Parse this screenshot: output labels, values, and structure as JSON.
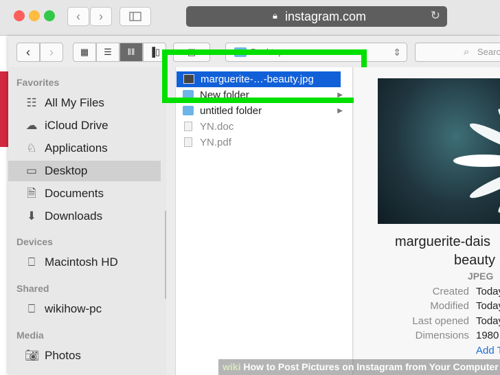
{
  "browser": {
    "url": "instagram.com"
  },
  "picker": {
    "location": "Desktop",
    "search_placeholder": "Search"
  },
  "sidebar": {
    "favorites_header": "Favorites",
    "favorites": [
      "All My Files",
      "iCloud Drive",
      "Applications",
      "Desktop",
      "Documents",
      "Downloads"
    ],
    "devices_header": "Devices",
    "devices": [
      "Macintosh HD"
    ],
    "shared_header": "Shared",
    "shared": [
      "wikihow-pc"
    ],
    "media_header": "Media",
    "media": [
      "Photos"
    ]
  },
  "files": [
    "marguerite-…-beauty.jpg",
    "New folder",
    "untitled folder",
    "YN.doc",
    "YN.pdf"
  ],
  "preview": {
    "title_line1": "marguerite-dais",
    "title_line2": "beauty",
    "kind": "JPEG",
    "labels": [
      "Created",
      "Modified",
      "Last opened",
      "Dimensions"
    ],
    "values": [
      "Today",
      "Today",
      "Today",
      "1980 ×"
    ],
    "add_tags": "Add Ta"
  },
  "watermark": {
    "brand": "wiki",
    "title": "How to Post Pictures on Instagram from Your Computer"
  },
  "colors": {
    "highlight": "#00e000",
    "selection": "#1160d8",
    "brand_red": "#d1293f"
  }
}
